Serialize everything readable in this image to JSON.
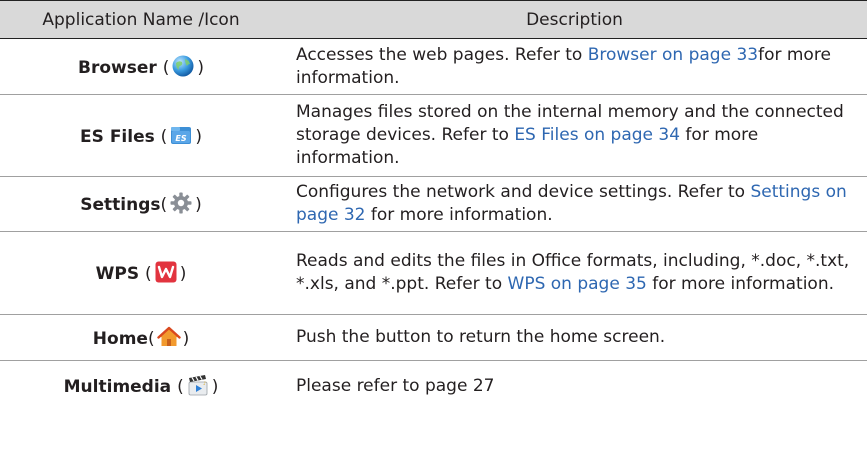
{
  "header": {
    "col1": "Application Name /Icon",
    "col2": "Description"
  },
  "rows": [
    {
      "name": "Browser",
      "desc_before": "Accesses the web pages. Refer to ",
      "link": "Browser on page 33",
      "desc_after": "for more information."
    },
    {
      "name": "ES Files",
      "desc_before": "Manages files stored on the internal memory and the connected storage devices. Refer to ",
      "link": "ES Files on page 34",
      "desc_after": " for more information."
    },
    {
      "name": "Settings",
      "desc_before": "Configures the network and device settings. Refer to ",
      "link": "Settings on page 32",
      "desc_after": " for more information."
    },
    {
      "name": "WPS",
      "desc_before": "Reads and edits the files in Office formats, including, *.doc, *.txt, *.xls, and *.ppt. Refer to ",
      "link": "WPS on page 35",
      "desc_after": " for more information."
    },
    {
      "name": "Home",
      "desc_before": "Push the button to return the home screen.",
      "link": "",
      "desc_after": ""
    },
    {
      "name": "Multimedia",
      "desc_before": "Please refer to page 27",
      "link": "",
      "desc_after": ""
    }
  ],
  "icons": [
    "globe-icon",
    "es-files-icon",
    "gear-icon",
    "wps-icon",
    "home-icon",
    "multimedia-icon"
  ],
  "colors": {
    "link": "#2e67b1",
    "header_bg": "#d9d9d9"
  }
}
